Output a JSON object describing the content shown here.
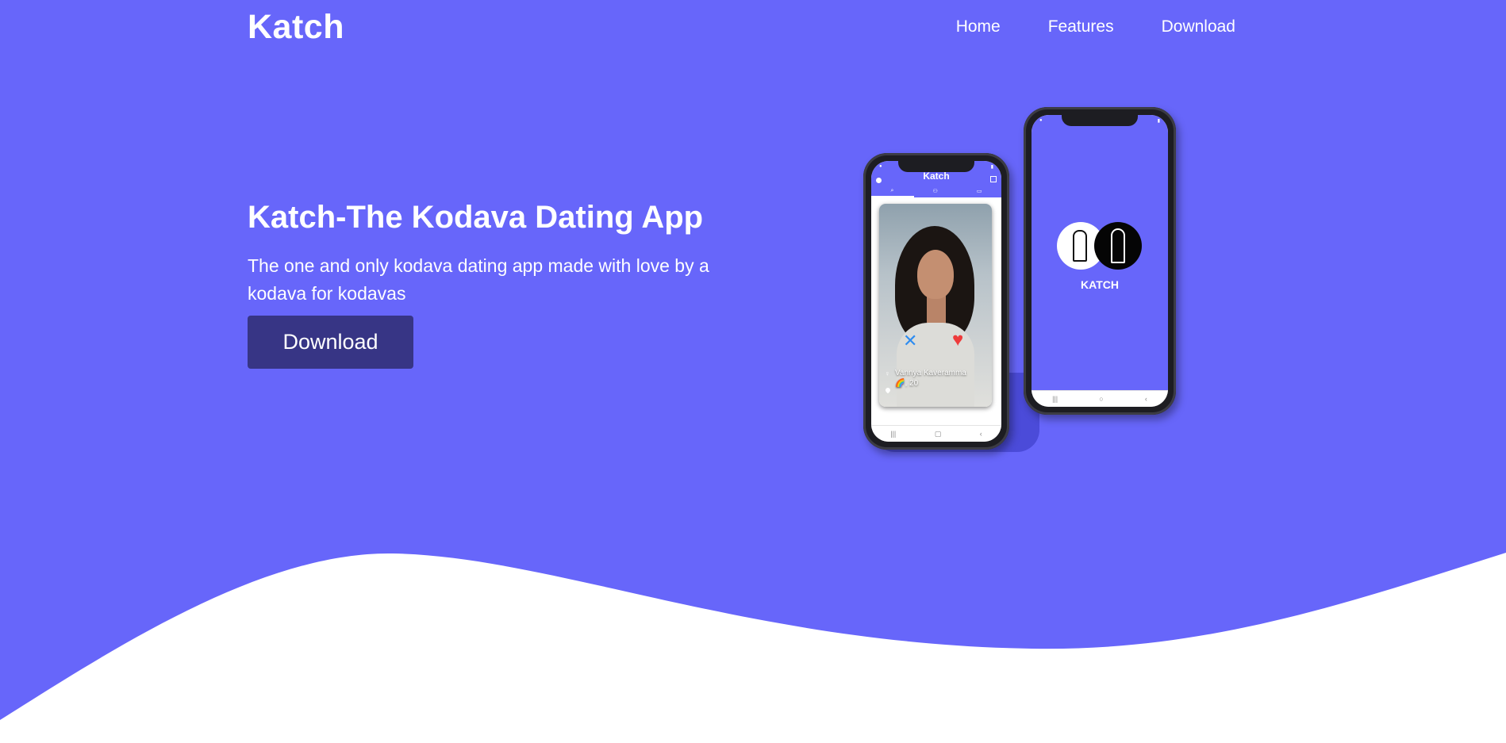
{
  "header": {
    "brand": "Katch",
    "nav": [
      "Home",
      "Features",
      "Download"
    ]
  },
  "hero": {
    "title": "Katch-The Kodava Dating App",
    "subtitle": "The one and only kodava dating app made with love by a kodava for kodavas",
    "button_label": "Download"
  },
  "phone_left": {
    "app_title": "Katch",
    "profile_name": "Vannya Kaveramma",
    "profile_age": "🌈, 20",
    "icons": [
      "search-icon",
      "people-icon",
      "chat-icon",
      "close-icon",
      "heart-icon",
      "location-pin-icon"
    ]
  },
  "phone_right": {
    "logo_text": "KATCH"
  },
  "colors": {
    "hero_bg": "#6766fa",
    "button_bg": "#373585",
    "wave_bg": "#ffffff",
    "dislike": "#2e8cf0",
    "like": "#ee3b3b"
  }
}
